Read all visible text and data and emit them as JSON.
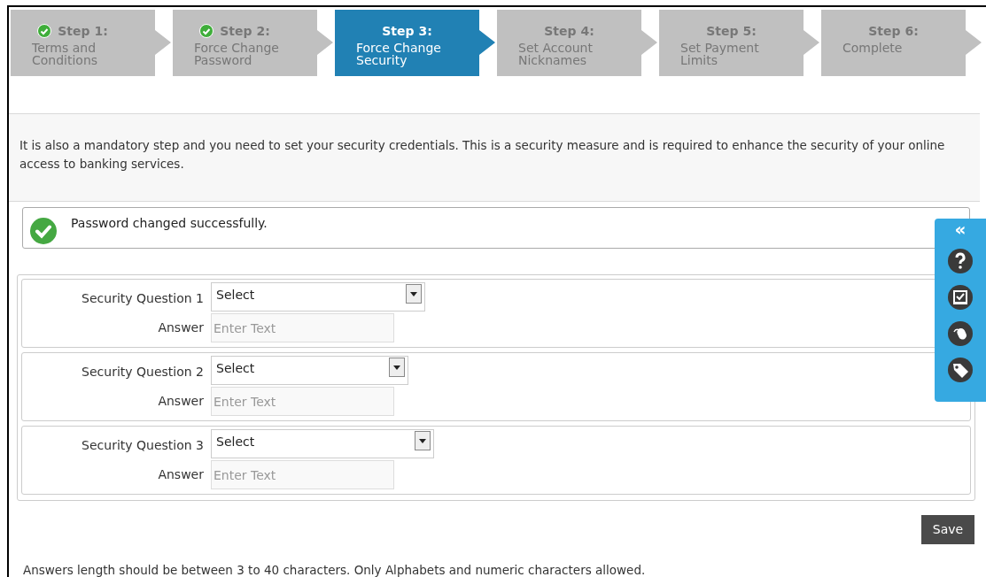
{
  "steps": [
    {
      "title": "Step 1:",
      "label": "Terms and Conditions",
      "completed": true,
      "selected": false
    },
    {
      "title": "Step 2:",
      "label": "Force Change Password",
      "completed": true,
      "selected": false
    },
    {
      "title": "Step 3:",
      "label": "Force Change Security",
      "completed": false,
      "selected": true
    },
    {
      "title": "Step 4:",
      "label": "Set Account Nicknames",
      "completed": false,
      "selected": false
    },
    {
      "title": "Step 5:",
      "label": "Set Payment Limits",
      "completed": false,
      "selected": false
    },
    {
      "title": "Step 6:",
      "label": "Complete",
      "completed": false,
      "selected": false
    }
  ],
  "description": "It is also a mandatory step and you need to set your security credentials. This is a security measure and is required to enhance the security of your online access to banking services.",
  "success_message": "Password changed successfully.",
  "questions": [
    {
      "label": "Security Question 1",
      "select_value": "Select",
      "answer_label": "Answer",
      "answer_placeholder": "Enter Text"
    },
    {
      "label": "Security Question 2",
      "select_value": "Select",
      "answer_label": "Answer",
      "answer_placeholder": "Enter Text"
    },
    {
      "label": "Security Question 3",
      "select_value": "Select",
      "answer_label": "Answer",
      "answer_placeholder": "Enter Text"
    }
  ],
  "save_button": "Save",
  "footer_note": "Answers length should be between 3 to 40 characters. Only Alphabets and numeric characters allowed.",
  "side_panel": {
    "collapse": "«"
  }
}
